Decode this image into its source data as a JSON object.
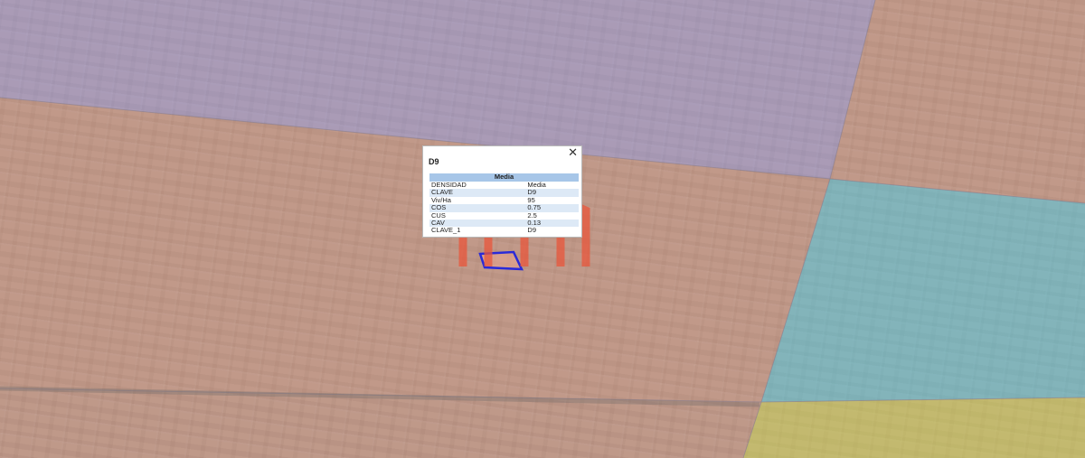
{
  "map": {
    "zone_colors": {
      "purple": "#b6a6df",
      "salmon": "#f0a78f",
      "cyan": "#76c8d6",
      "yellow": "#d9cf63",
      "selected_outline": "#2a2ad8",
      "watermark": "#e8553b"
    },
    "watermark_icon": "logo-watermark-icon"
  },
  "popup": {
    "title": "D9",
    "close_glyph": "✕",
    "header": "Media",
    "rows": [
      {
        "key": "DENSIDAD",
        "value": "Media"
      },
      {
        "key": "CLAVE",
        "value": "D9"
      },
      {
        "key": "Viv/Ha",
        "value": "95"
      },
      {
        "key": "COS",
        "value": "0.75"
      },
      {
        "key": "CUS",
        "value": "2.5"
      },
      {
        "key": "CAV",
        "value": "0.13"
      },
      {
        "key": "CLAVE_1",
        "value": "D9"
      }
    ]
  }
}
